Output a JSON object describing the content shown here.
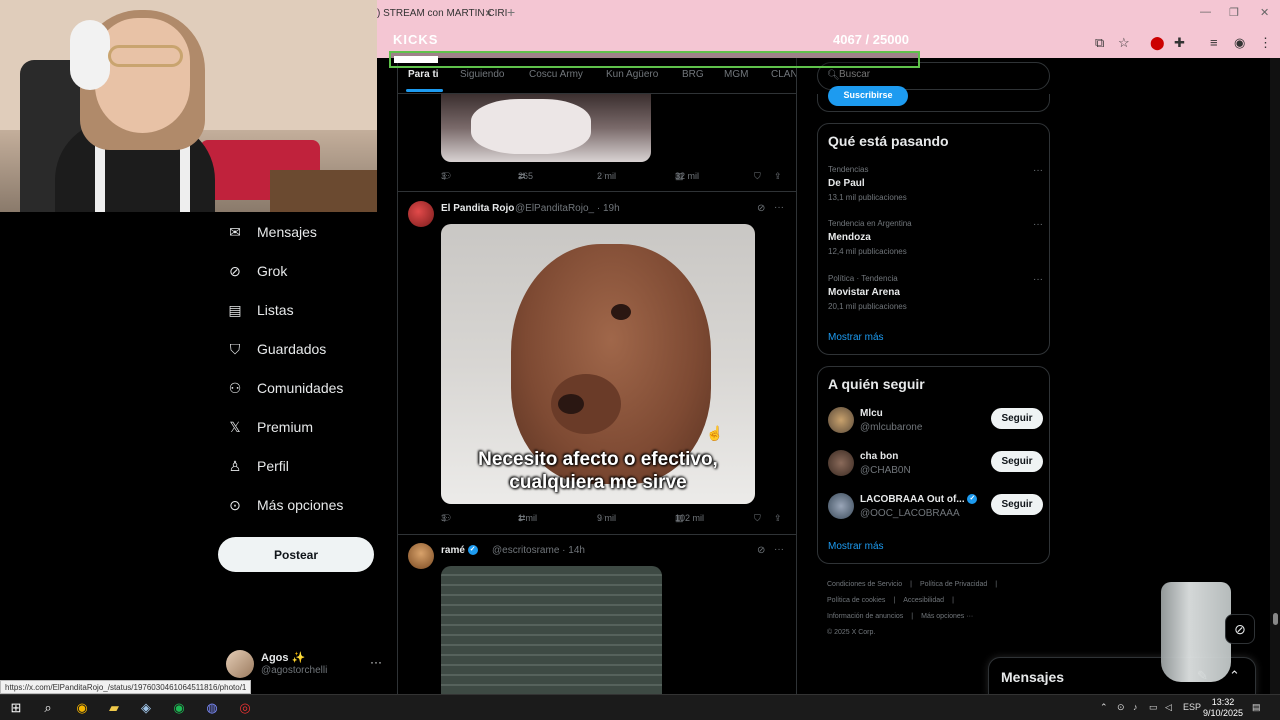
{
  "browser": {
    "tab_title": ") STREAM con MARTIN CIRI",
    "tab_close": "×",
    "new_tab": "+",
    "window_minimize": "—",
    "window_restore": "❐",
    "window_close": "✕"
  },
  "overlay": {
    "kicks_label": "KICKS",
    "kicks_current": "4067",
    "kicks_goal": "/ 25000",
    "kicks_progress": 0.1627
  },
  "nav": {
    "items": [
      {
        "label": "Mensajes",
        "icon": "mail-icon"
      },
      {
        "label": "Grok",
        "icon": "grok-icon"
      },
      {
        "label": "Listas",
        "icon": "list-icon"
      },
      {
        "label": "Guardados",
        "icon": "bookmark-icon"
      },
      {
        "label": "Comunidades",
        "icon": "communities-icon"
      },
      {
        "label": "Premium",
        "icon": "x-logo-icon"
      },
      {
        "label": "Perfil",
        "icon": "person-icon"
      },
      {
        "label": "Más opciones",
        "icon": "more-circle-icon"
      }
    ],
    "post_button": "Postear",
    "account_name": "Agos ✨",
    "account_handle": "@agostorchelli",
    "account_more": "···"
  },
  "feed": {
    "tabs": [
      {
        "label": "Para ti",
        "active": true
      },
      {
        "label": "Siguiendo",
        "active": false
      },
      {
        "label": "Coscu Army",
        "active": false
      },
      {
        "label": "Kun Agüero",
        "active": false
      },
      {
        "label": "BRG",
        "active": false
      },
      {
        "label": "MGM",
        "active": false
      },
      {
        "label": "CLAN",
        "active": false
      }
    ],
    "post1": {
      "replies": "3",
      "reposts": "265",
      "likes": "2 mil",
      "views": "32 mil"
    },
    "post2": {
      "author": "El Pandita Rojo",
      "meta": "@ElPanditaRojo_ · 19h",
      "caption_line1": "Necesito afecto o efectivo,",
      "caption_line2": "cualquiera me sirve",
      "replies": "3",
      "reposts": "1 mil",
      "likes": "9 mil",
      "views": "102 mil"
    },
    "post3": {
      "author": "ramé",
      "meta": "@escritosrame · 14h"
    }
  },
  "sidebar": {
    "search_placeholder": "Buscar",
    "subscribe_label": "Suscribirse",
    "trends_title": "Qué está pasando",
    "trends": [
      {
        "context": "Tendencias",
        "topic": "De Paul",
        "count": "13,1 mil publicaciones"
      },
      {
        "context": "Tendencia en Argentina",
        "topic": "Mendoza",
        "count": "12,4 mil publicaciones"
      },
      {
        "context": "Política · Tendencia",
        "topic": "Movistar Arena",
        "count": "20,1 mil publicaciones"
      }
    ],
    "show_more": "Mostrar más",
    "follow_title": "A quién seguir",
    "follow": [
      {
        "name": "Mlcu",
        "handle": "@mlcubarone",
        "button": "Seguir",
        "verified": false
      },
      {
        "name": "cha bon",
        "handle": "@CHAB0N",
        "button": "Seguir",
        "verified": false
      },
      {
        "name": "LACOBRAAA Out of...",
        "handle": "@OOC_LACOBRAAA",
        "button": "Seguir",
        "verified": true
      }
    ],
    "follow_show_more": "Mostrar más",
    "footer": {
      "terms": "Condiciones de Servicio",
      "privacy": "Política de Privacidad",
      "cookies": "Política de cookies",
      "accessibility": "Accesibilidad",
      "ads_info": "Información de anuncios",
      "more": "Más opciones ···",
      "copyright": "© 2025 X Corp."
    }
  },
  "messages_drawer": {
    "title": "Mensajes"
  },
  "status_url": "https://x.com/ElPanditaRojo_/status/1976030461064511816/photo/1",
  "taskbar": {
    "language": "ESP",
    "time": "13:32",
    "date": "9/10/2025"
  }
}
